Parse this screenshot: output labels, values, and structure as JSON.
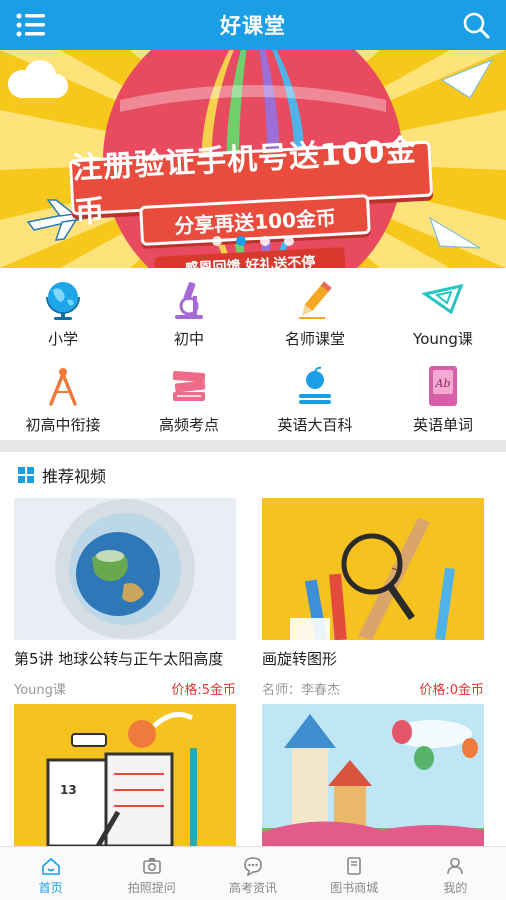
{
  "header": {
    "title": "好课堂"
  },
  "banner": {
    "headline": "注册验证手机号送100金币",
    "subline": "分享再送100金币",
    "tagline": "感恩回馈  好礼送不停",
    "slide_count": 5,
    "active_slide": 2
  },
  "categories": [
    {
      "label": "小学",
      "icon": "globe-icon"
    },
    {
      "label": "初中",
      "icon": "microscope-icon"
    },
    {
      "label": "名师课堂",
      "icon": "pencil-icon"
    },
    {
      "label": "Young课",
      "icon": "set-square-icon"
    },
    {
      "label": "初高中衔接",
      "icon": "compass-icon"
    },
    {
      "label": "高频考点",
      "icon": "books-icon"
    },
    {
      "label": "英语大百科",
      "icon": "apple-book-icon"
    },
    {
      "label": "英语单词",
      "icon": "notebook-icon"
    }
  ],
  "recommend": {
    "title": "推荐视频",
    "videos": [
      {
        "title": "第5讲 地球公转与正午太阳高度",
        "source": "Young课",
        "price": "价格:5金币"
      },
      {
        "title": "画旋转图形",
        "source": "名师：李春杰",
        "price": "价格:0金币"
      },
      {
        "title": "",
        "source": "",
        "price": ""
      },
      {
        "title": "",
        "source": "",
        "price": ""
      }
    ]
  },
  "tabbar": [
    {
      "label": "首页",
      "icon": "home-icon",
      "active": true
    },
    {
      "label": "拍照提问",
      "icon": "camera-icon",
      "active": false
    },
    {
      "label": "高考资讯",
      "icon": "chat-icon",
      "active": false
    },
    {
      "label": "图书商城",
      "icon": "book-icon",
      "active": false
    },
    {
      "label": "我的",
      "icon": "user-icon",
      "active": false
    }
  ],
  "colors": {
    "primary": "#1a9fe6",
    "price": "#e33333",
    "banner_bg": "#f7c81c",
    "ribbon": "#e94b3c"
  }
}
